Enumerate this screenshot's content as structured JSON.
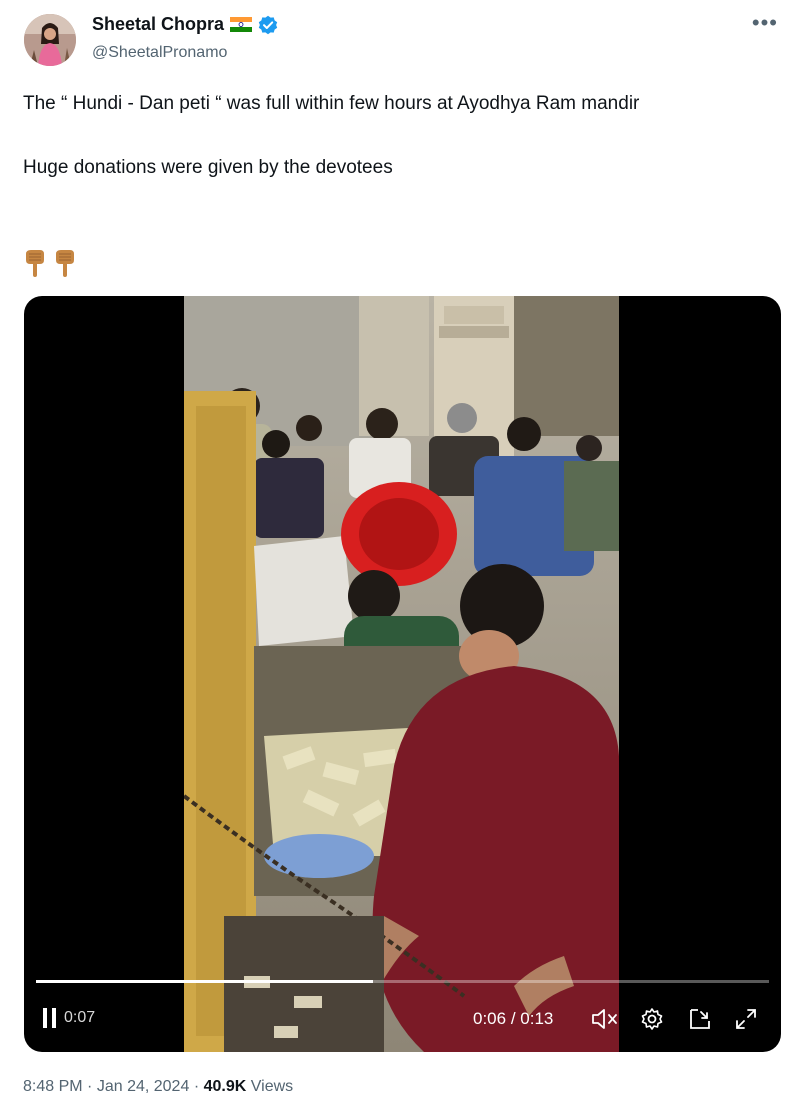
{
  "author": {
    "name": "Sheetal Chopra",
    "handle": "@SheetalPronamo",
    "flag_icon": "india-flag-icon",
    "verified_icon": "verified-badge-icon"
  },
  "tweet": {
    "text": "The “ Hundi - Dan peti “ was full within few hours at Ayodhya Ram mandir\n\nHuge donations were given by the devotees",
    "emoji_icons": [
      "pointing-down-icon",
      "pointing-down-icon"
    ]
  },
  "video": {
    "elapsed_overlay": "0:07",
    "current_time": "0:06",
    "separator": "/",
    "duration": "0:13",
    "progress_fraction": 0.46
  },
  "footer": {
    "time": "8:48 PM",
    "dot": "·",
    "date": "Jan 24, 2024",
    "views_count": "40.9K",
    "views_label": "Views"
  },
  "colors": {
    "text_primary": "#0f1419",
    "text_secondary": "#536471",
    "verified_blue": "#1d9bf0"
  }
}
